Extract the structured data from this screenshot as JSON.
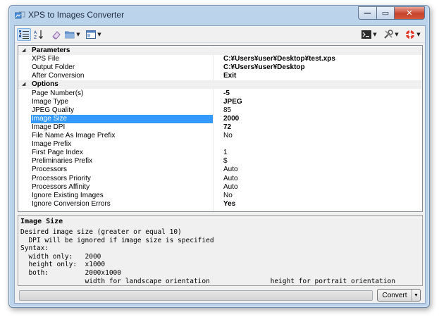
{
  "window": {
    "title": "XPS to Images Converter"
  },
  "caption_buttons": {
    "minimize": "—",
    "maximize": "▭",
    "close": "✕"
  },
  "toolbar": {
    "left": [
      {
        "name": "categorized-view-button",
        "icon": "categorized-icon",
        "active": true,
        "dropdown": false
      },
      {
        "name": "alphabetical-sort-button",
        "icon": "sort-az-icon",
        "active": false,
        "dropdown": false
      },
      {
        "name": "eraser-button",
        "icon": "eraser-icon",
        "active": false,
        "dropdown": false
      },
      {
        "name": "open-folder-button",
        "icon": "folder-icon",
        "active": false,
        "dropdown": true
      },
      {
        "name": "view-options-button",
        "icon": "window-layout-icon",
        "active": false,
        "dropdown": true
      }
    ],
    "right": [
      {
        "name": "console-button",
        "icon": "console-icon",
        "dropdown": true
      },
      {
        "name": "tools-button",
        "icon": "tools-icon",
        "dropdown": true
      },
      {
        "name": "help-lifebuoy-button",
        "icon": "lifebuoy-icon",
        "dropdown": true
      }
    ]
  },
  "properties": {
    "rows": [
      {
        "type": "category",
        "label": "Parameters",
        "toggle": "◢"
      },
      {
        "type": "prop",
        "name": "XPS File",
        "value": "C:¥Users¥user¥Desktop¥test.xps",
        "bold": true
      },
      {
        "type": "prop",
        "name": "Output Folder",
        "value": "C:¥Users¥user¥Desktop",
        "bold": true
      },
      {
        "type": "prop",
        "name": "After Conversion",
        "value": "Exit",
        "bold": true
      },
      {
        "type": "category",
        "label": "Options",
        "toggle": "◢"
      },
      {
        "type": "prop",
        "name": "Page Number(s)",
        "value": "-5",
        "bold": true
      },
      {
        "type": "prop",
        "name": "Image Type",
        "value": "JPEG",
        "bold": true
      },
      {
        "type": "prop",
        "name": "JPEG Quality",
        "value": "85",
        "bold": false
      },
      {
        "type": "prop",
        "name": "Image Size",
        "value": "2000",
        "bold": true,
        "selected": true
      },
      {
        "type": "prop",
        "name": "Image DPI",
        "value": "72",
        "bold": true
      },
      {
        "type": "prop",
        "name": "File Name As Image Prefix",
        "value": "No",
        "bold": false
      },
      {
        "type": "prop",
        "name": "Image Prefix",
        "value": "",
        "bold": false
      },
      {
        "type": "prop",
        "name": "First Page Index",
        "value": "1",
        "bold": false
      },
      {
        "type": "prop",
        "name": "Preliminaries Prefix",
        "value": "$",
        "bold": false
      },
      {
        "type": "prop",
        "name": "Processors",
        "value": "Auto",
        "bold": false
      },
      {
        "type": "prop",
        "name": "Processors Priority",
        "value": "Auto",
        "bold": false
      },
      {
        "type": "prop",
        "name": "Processors Affinity",
        "value": "Auto",
        "bold": false
      },
      {
        "type": "prop",
        "name": "Ignore Existing Images",
        "value": "No",
        "bold": false
      },
      {
        "type": "prop",
        "name": "Ignore Conversion Errors",
        "value": "Yes",
        "bold": true
      }
    ]
  },
  "help": {
    "title": "Image Size",
    "lines": [
      "Desired image size (greater or equal 10)",
      "  DPI will be ignored if image size is specified",
      "Syntax:",
      "  width only:   2000",
      "  height only:  x1000",
      "  both:         2000x1000",
      "                width for landscape orientation               height for portrait orientation"
    ]
  },
  "status": {
    "progress": 0,
    "convert_label": "Convert",
    "convert_arrow": "▼"
  },
  "colors": {
    "selection": "#3399ff",
    "frame": "#bcd3ec",
    "close_button": "#c7442c"
  }
}
